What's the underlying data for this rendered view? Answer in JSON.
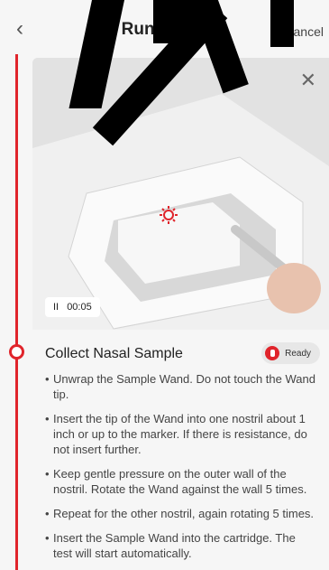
{
  "header": {
    "back": "‹",
    "title": "Run a Test",
    "cancel": "Cancel"
  },
  "video": {
    "close": "✕",
    "pause": "II",
    "time": "00:05"
  },
  "section": {
    "title": "Collect Nasal Sample",
    "status": "Ready",
    "steps": [
      "Unwrap the Sample Wand. Do not touch the Wand tip.",
      "Insert the tip of the Wand into one nostril about 1 inch or up to the marker. If there is resistance, do not insert further.",
      "Keep gentle pressure on the outer wall of the nostril. Rotate the Wand against the wall 5 times.",
      "Repeat for the other nostril, again rotating 5 times.",
      "Insert the Sample Wand into the cartridge. The test will start automatically."
    ]
  },
  "colors": {
    "accent": "#e0242b"
  }
}
